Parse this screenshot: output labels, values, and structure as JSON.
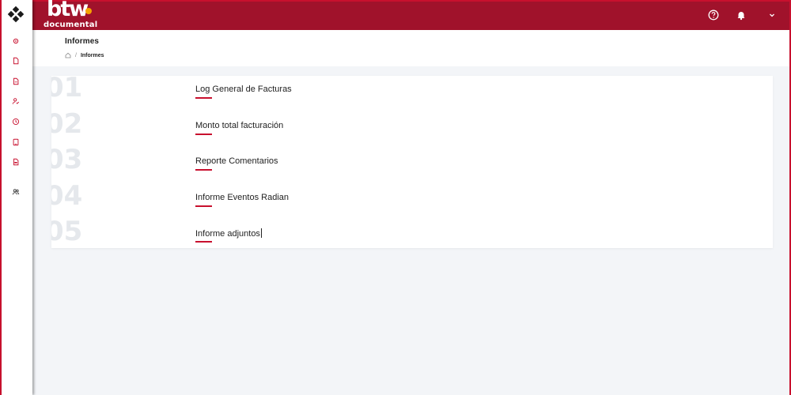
{
  "app": {
    "brand_top": "btw",
    "brand_bottom": "documental",
    "accent_color": "#a0122b",
    "highlight_color": "#c8102e"
  },
  "sidebar": {
    "items": [
      {
        "icon": "gear-icon"
      },
      {
        "icon": "document-icon"
      },
      {
        "icon": "document-icon"
      },
      {
        "icon": "user-check-icon"
      },
      {
        "icon": "clock-icon"
      },
      {
        "icon": "tablet-icon"
      },
      {
        "icon": "pdf-document-icon"
      },
      {
        "icon": "users-icon"
      }
    ]
  },
  "header": {
    "icons": [
      "help-icon",
      "bell-icon",
      "chevron-down-icon"
    ]
  },
  "page": {
    "title": "Informes",
    "breadcrumb": {
      "separator": "/",
      "current": "Informes"
    }
  },
  "reports": [
    {
      "number": "01",
      "label": "Log General de Facturas"
    },
    {
      "number": "02",
      "label": "Monto total facturación"
    },
    {
      "number": "03",
      "label": "Reporte Comentarios"
    },
    {
      "number": "04",
      "label": "Informe Eventos Radian"
    },
    {
      "number": "05",
      "label": "Informe adjuntos"
    }
  ]
}
